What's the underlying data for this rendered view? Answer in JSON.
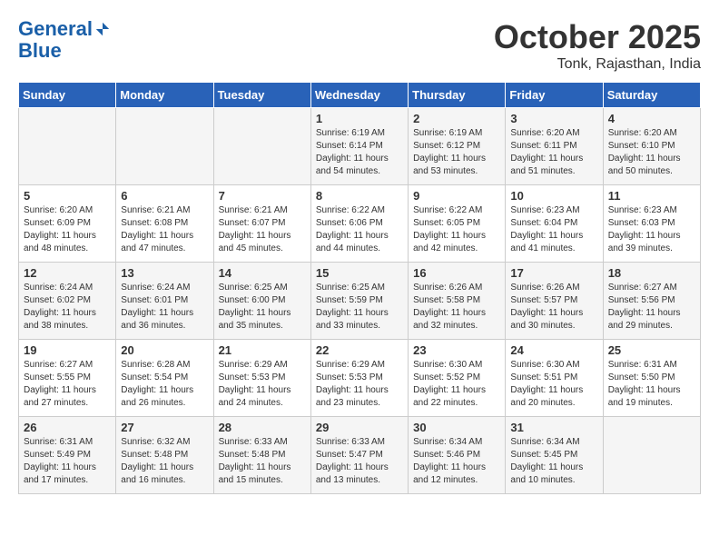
{
  "header": {
    "logo_line1": "General",
    "logo_line2": "Blue",
    "month": "October 2025",
    "location": "Tonk, Rajasthan, India"
  },
  "days_of_week": [
    "Sunday",
    "Monday",
    "Tuesday",
    "Wednesday",
    "Thursday",
    "Friday",
    "Saturday"
  ],
  "weeks": [
    [
      {
        "num": "",
        "sunrise": "",
        "sunset": "",
        "daylight": ""
      },
      {
        "num": "",
        "sunrise": "",
        "sunset": "",
        "daylight": ""
      },
      {
        "num": "",
        "sunrise": "",
        "sunset": "",
        "daylight": ""
      },
      {
        "num": "1",
        "sunrise": "Sunrise: 6:19 AM",
        "sunset": "Sunset: 6:14 PM",
        "daylight": "Daylight: 11 hours and 54 minutes."
      },
      {
        "num": "2",
        "sunrise": "Sunrise: 6:19 AM",
        "sunset": "Sunset: 6:12 PM",
        "daylight": "Daylight: 11 hours and 53 minutes."
      },
      {
        "num": "3",
        "sunrise": "Sunrise: 6:20 AM",
        "sunset": "Sunset: 6:11 PM",
        "daylight": "Daylight: 11 hours and 51 minutes."
      },
      {
        "num": "4",
        "sunrise": "Sunrise: 6:20 AM",
        "sunset": "Sunset: 6:10 PM",
        "daylight": "Daylight: 11 hours and 50 minutes."
      }
    ],
    [
      {
        "num": "5",
        "sunrise": "Sunrise: 6:20 AM",
        "sunset": "Sunset: 6:09 PM",
        "daylight": "Daylight: 11 hours and 48 minutes."
      },
      {
        "num": "6",
        "sunrise": "Sunrise: 6:21 AM",
        "sunset": "Sunset: 6:08 PM",
        "daylight": "Daylight: 11 hours and 47 minutes."
      },
      {
        "num": "7",
        "sunrise": "Sunrise: 6:21 AM",
        "sunset": "Sunset: 6:07 PM",
        "daylight": "Daylight: 11 hours and 45 minutes."
      },
      {
        "num": "8",
        "sunrise": "Sunrise: 6:22 AM",
        "sunset": "Sunset: 6:06 PM",
        "daylight": "Daylight: 11 hours and 44 minutes."
      },
      {
        "num": "9",
        "sunrise": "Sunrise: 6:22 AM",
        "sunset": "Sunset: 6:05 PM",
        "daylight": "Daylight: 11 hours and 42 minutes."
      },
      {
        "num": "10",
        "sunrise": "Sunrise: 6:23 AM",
        "sunset": "Sunset: 6:04 PM",
        "daylight": "Daylight: 11 hours and 41 minutes."
      },
      {
        "num": "11",
        "sunrise": "Sunrise: 6:23 AM",
        "sunset": "Sunset: 6:03 PM",
        "daylight": "Daylight: 11 hours and 39 minutes."
      }
    ],
    [
      {
        "num": "12",
        "sunrise": "Sunrise: 6:24 AM",
        "sunset": "Sunset: 6:02 PM",
        "daylight": "Daylight: 11 hours and 38 minutes."
      },
      {
        "num": "13",
        "sunrise": "Sunrise: 6:24 AM",
        "sunset": "Sunset: 6:01 PM",
        "daylight": "Daylight: 11 hours and 36 minutes."
      },
      {
        "num": "14",
        "sunrise": "Sunrise: 6:25 AM",
        "sunset": "Sunset: 6:00 PM",
        "daylight": "Daylight: 11 hours and 35 minutes."
      },
      {
        "num": "15",
        "sunrise": "Sunrise: 6:25 AM",
        "sunset": "Sunset: 5:59 PM",
        "daylight": "Daylight: 11 hours and 33 minutes."
      },
      {
        "num": "16",
        "sunrise": "Sunrise: 6:26 AM",
        "sunset": "Sunset: 5:58 PM",
        "daylight": "Daylight: 11 hours and 32 minutes."
      },
      {
        "num": "17",
        "sunrise": "Sunrise: 6:26 AM",
        "sunset": "Sunset: 5:57 PM",
        "daylight": "Daylight: 11 hours and 30 minutes."
      },
      {
        "num": "18",
        "sunrise": "Sunrise: 6:27 AM",
        "sunset": "Sunset: 5:56 PM",
        "daylight": "Daylight: 11 hours and 29 minutes."
      }
    ],
    [
      {
        "num": "19",
        "sunrise": "Sunrise: 6:27 AM",
        "sunset": "Sunset: 5:55 PM",
        "daylight": "Daylight: 11 hours and 27 minutes."
      },
      {
        "num": "20",
        "sunrise": "Sunrise: 6:28 AM",
        "sunset": "Sunset: 5:54 PM",
        "daylight": "Daylight: 11 hours and 26 minutes."
      },
      {
        "num": "21",
        "sunrise": "Sunrise: 6:29 AM",
        "sunset": "Sunset: 5:53 PM",
        "daylight": "Daylight: 11 hours and 24 minutes."
      },
      {
        "num": "22",
        "sunrise": "Sunrise: 6:29 AM",
        "sunset": "Sunset: 5:53 PM",
        "daylight": "Daylight: 11 hours and 23 minutes."
      },
      {
        "num": "23",
        "sunrise": "Sunrise: 6:30 AM",
        "sunset": "Sunset: 5:52 PM",
        "daylight": "Daylight: 11 hours and 22 minutes."
      },
      {
        "num": "24",
        "sunrise": "Sunrise: 6:30 AM",
        "sunset": "Sunset: 5:51 PM",
        "daylight": "Daylight: 11 hours and 20 minutes."
      },
      {
        "num": "25",
        "sunrise": "Sunrise: 6:31 AM",
        "sunset": "Sunset: 5:50 PM",
        "daylight": "Daylight: 11 hours and 19 minutes."
      }
    ],
    [
      {
        "num": "26",
        "sunrise": "Sunrise: 6:31 AM",
        "sunset": "Sunset: 5:49 PM",
        "daylight": "Daylight: 11 hours and 17 minutes."
      },
      {
        "num": "27",
        "sunrise": "Sunrise: 6:32 AM",
        "sunset": "Sunset: 5:48 PM",
        "daylight": "Daylight: 11 hours and 16 minutes."
      },
      {
        "num": "28",
        "sunrise": "Sunrise: 6:33 AM",
        "sunset": "Sunset: 5:48 PM",
        "daylight": "Daylight: 11 hours and 15 minutes."
      },
      {
        "num": "29",
        "sunrise": "Sunrise: 6:33 AM",
        "sunset": "Sunset: 5:47 PM",
        "daylight": "Daylight: 11 hours and 13 minutes."
      },
      {
        "num": "30",
        "sunrise": "Sunrise: 6:34 AM",
        "sunset": "Sunset: 5:46 PM",
        "daylight": "Daylight: 11 hours and 12 minutes."
      },
      {
        "num": "31",
        "sunrise": "Sunrise: 6:34 AM",
        "sunset": "Sunset: 5:45 PM",
        "daylight": "Daylight: 11 hours and 10 minutes."
      },
      {
        "num": "",
        "sunrise": "",
        "sunset": "",
        "daylight": ""
      }
    ]
  ]
}
